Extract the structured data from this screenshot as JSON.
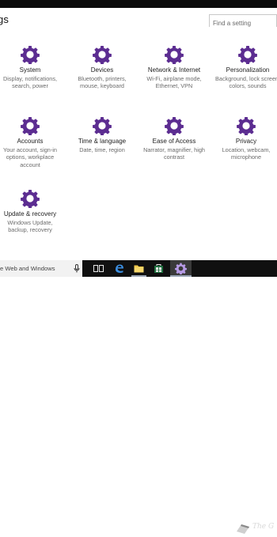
{
  "window": {
    "title_partial": "gs"
  },
  "search": {
    "placeholder": "Find a setting"
  },
  "tiles": [
    {
      "label": "System",
      "desc": [
        "Display, notifications,",
        "search, power"
      ],
      "icon": "gear-icon"
    },
    {
      "label": "Devices",
      "desc": [
        "Bluetooth, printers,",
        "mouse, keyboard"
      ],
      "icon": "gear-icon"
    },
    {
      "label": "Network & Internet",
      "desc": [
        "Wi-Fi, airplane mode,",
        "Ethernet, VPN"
      ],
      "icon": "gear-icon"
    },
    {
      "label": "Personalization",
      "desc": [
        "Background, lock screen,",
        "colors, sounds"
      ],
      "icon": "gear-icon"
    },
    {
      "label": "Accounts",
      "desc": [
        "Your account, sign-in",
        "options, workplace",
        "account"
      ],
      "icon": "gear-icon"
    },
    {
      "label": "Time & language",
      "desc": [
        "Date, time, region"
      ],
      "icon": "gear-icon"
    },
    {
      "label": "Ease of Access",
      "desc": [
        "Narrator, magnifier, high",
        "contrast"
      ],
      "icon": "gear-icon"
    },
    {
      "label": "Privacy",
      "desc": [
        "Location, webcam,",
        "microphone"
      ],
      "icon": "gear-icon"
    },
    {
      "label": "Update & recovery",
      "desc": [
        "Windows Update,",
        "backup, recovery"
      ],
      "icon": "gear-icon"
    }
  ],
  "taskbar": {
    "search_placeholder": "e Web and Windows",
    "watermark_text": "The G"
  },
  "colors": {
    "accent": "#5c2d91",
    "taskbar": "#101010",
    "active_app": "#3a3a3a"
  }
}
